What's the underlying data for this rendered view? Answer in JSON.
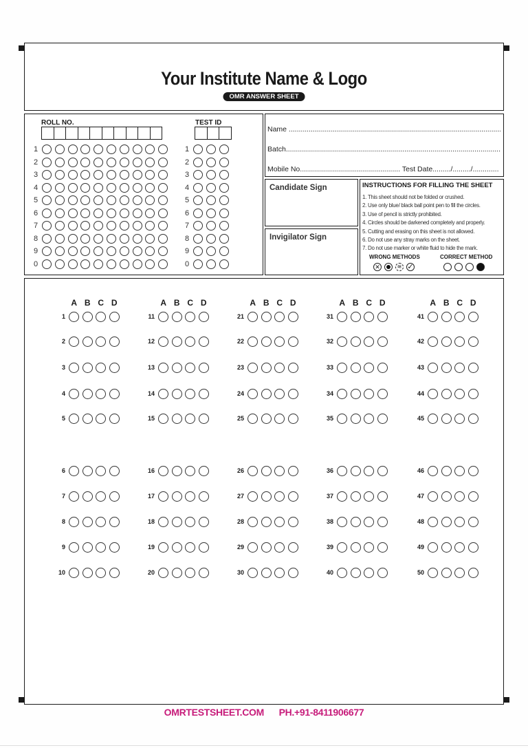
{
  "header": {
    "title": "Your Institute Name & Logo",
    "subtitle": "OMR ANSWER SHEET"
  },
  "roll_no": {
    "label": "ROLL NO.",
    "columns": 10,
    "digits": [
      "1",
      "2",
      "3",
      "4",
      "5",
      "6",
      "7",
      "8",
      "9",
      "0"
    ]
  },
  "test_id": {
    "label": "TEST ID",
    "columns": 3,
    "digits": [
      "1",
      "2",
      "3",
      "4",
      "5",
      "6",
      "7",
      "8",
      "9",
      "0"
    ]
  },
  "info": {
    "name": "Name ............................................................................................................................",
    "batch": "Batch..............................................................................................................................",
    "mobile_test_date": "Mobile No.................................................. Test Date........./........./............."
  },
  "signs": {
    "candidate": "Candidate Sign",
    "invigilator": "Invigilator Sign"
  },
  "instructions": {
    "title": "INSTRUCTIONS FOR FILLING THE SHEET",
    "items": [
      "1.  This sheet should not be folded or crushed.",
      "2.  Use only blue/ black ball point pen to fill the circles.",
      "3.  Use of pencil is strictly prohibited.",
      "4.  Circles should be darkened completely and properly.",
      "5.  Cutting and erasing on this sheet is not allowed.",
      "6.  Do not use any stray marks on the sheet.",
      "7.  Do not use marker or white fluid to hide the mark."
    ],
    "wrong_label": "WRONG METHODS",
    "correct_label": "CORRECT METHOD",
    "wrong_icons": [
      "cross-mark",
      "dot-mark",
      "scribble-mark",
      "tick-mark"
    ],
    "correct_icons": [
      "empty",
      "empty",
      "empty",
      "filled"
    ]
  },
  "answers": {
    "options": [
      "A",
      "B",
      "C",
      "D"
    ],
    "columns": [
      {
        "start": 1,
        "end": 10
      },
      {
        "start": 11,
        "end": 20
      },
      {
        "start": 21,
        "end": 30
      },
      {
        "start": 31,
        "end": 40
      },
      {
        "start": 41,
        "end": 50
      }
    ]
  },
  "footer": {
    "website": "OMRTESTSHEET.COM",
    "phone": "PH.+91-8411906677",
    "color": "#c71b7a"
  }
}
